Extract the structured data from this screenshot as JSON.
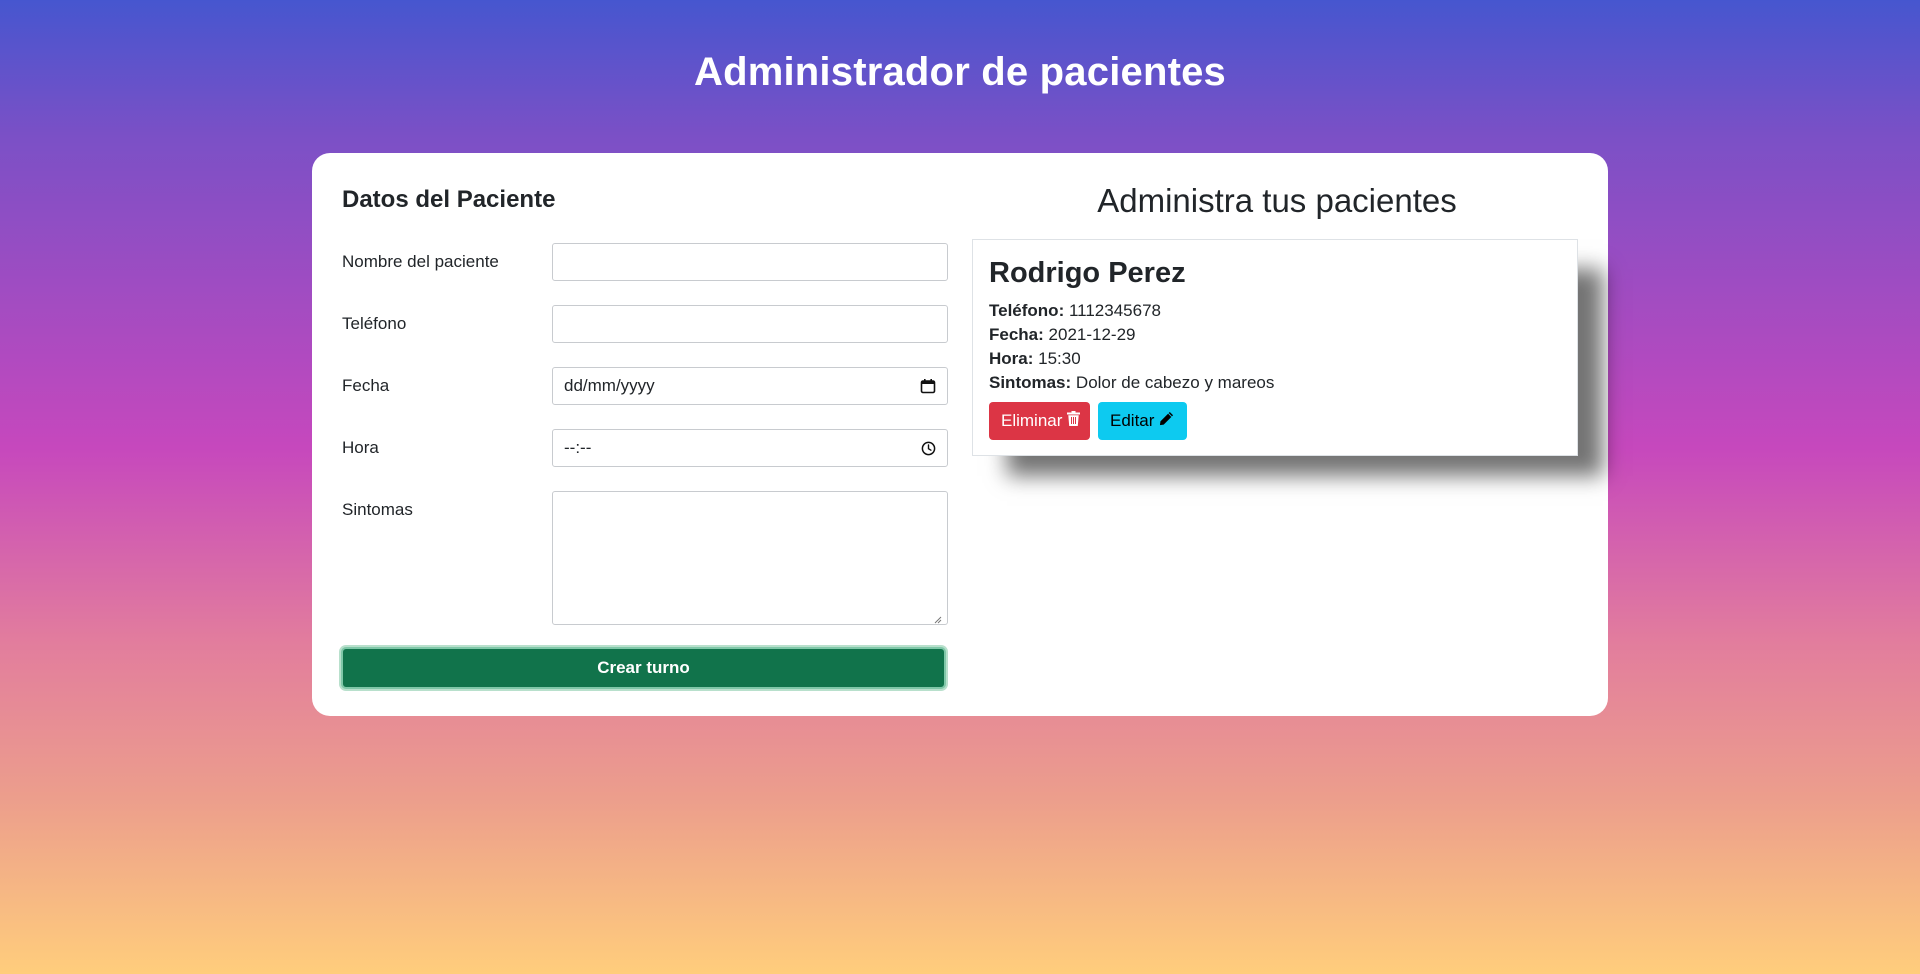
{
  "header": {
    "title": "Administrador de pacientes"
  },
  "form": {
    "title": "Datos del Paciente",
    "fields": {
      "nombre": {
        "label": "Nombre del paciente",
        "value": ""
      },
      "telefono": {
        "label": "Teléfono",
        "value": ""
      },
      "fecha": {
        "label": "Fecha",
        "placeholder": "dd/mm/yyyy"
      },
      "hora": {
        "label": "Hora",
        "placeholder": "--:--"
      },
      "sintomas": {
        "label": "Sintomas",
        "value": ""
      }
    },
    "submit_label": "Crear turno"
  },
  "list": {
    "title": "Administra tus pacientes",
    "patients": [
      {
        "name": "Rodrigo Perez",
        "telefono_label": "Teléfono:",
        "telefono": "1112345678",
        "fecha_label": "Fecha:",
        "fecha": "2021-12-29",
        "hora_label": "Hora:",
        "hora": "15:30",
        "sintomas_label": "Sintomas:",
        "sintomas": "Dolor de cabezo y mareos",
        "delete_label": "Eliminar",
        "edit_label": "Editar"
      }
    ]
  },
  "colors": {
    "success": "#11734b",
    "danger": "#dc3545",
    "info": "#0dcaf0"
  },
  "icons": {
    "delete": "trash-icon",
    "edit": "pencil-icon",
    "date": "calendar-icon",
    "time": "clock-icon"
  }
}
